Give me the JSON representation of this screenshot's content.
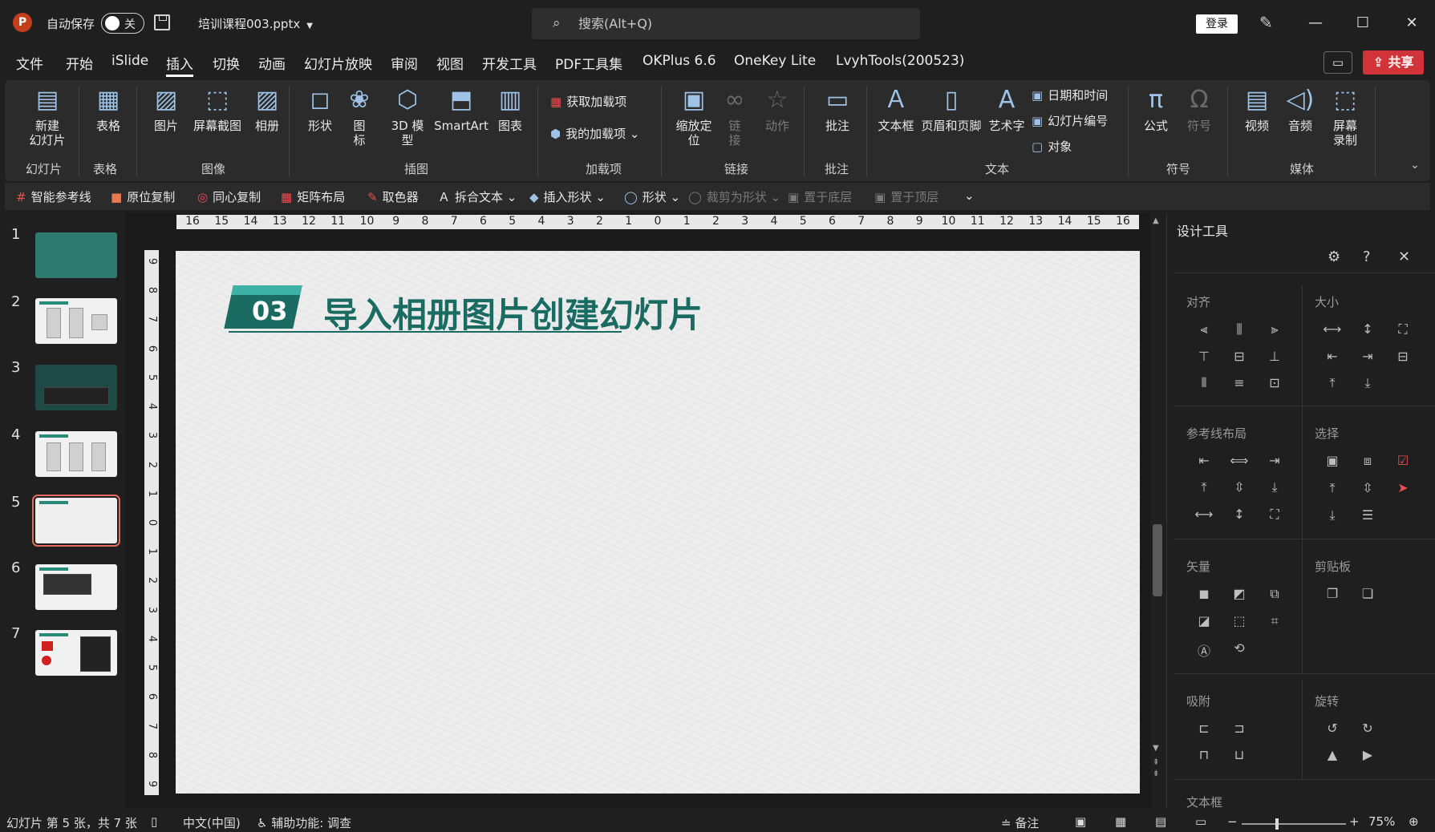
{
  "titlebar": {
    "app_logo": "P",
    "autosave_label": "自动保存",
    "autosave_state": "关",
    "file_name": "培训课程003.pptx",
    "search_placeholder": "搜索(Alt+Q)",
    "login_label": "登录"
  },
  "menu": {
    "items": [
      "文件",
      "开始",
      "iSlide",
      "插入",
      "切换",
      "动画",
      "幻灯片放映",
      "审阅",
      "视图",
      "开发工具",
      "PDF工具集",
      "OKPlus 6.6",
      "OneKey Lite",
      "LvyhTools(200523)"
    ],
    "active": "插入",
    "share_label": "共享"
  },
  "ribbon": {
    "buttons": {
      "new_slide": "新建\n幻灯片",
      "table": "表格",
      "picture": "图片",
      "screenshot": "屏幕截图",
      "album": "相册",
      "shape": "形状",
      "icon": "图\n标",
      "model3d": "3D 模\n型",
      "smartart": "SmartArt",
      "chart": "图表",
      "get_addins": "获取加载项",
      "my_addins": "我的加载项",
      "zoom": "缩放定\n位",
      "link": "链\n接",
      "action": "动作",
      "comment": "批注",
      "textbox": "文本框",
      "header_footer": "页眉和页脚",
      "wordart": "艺术字",
      "date_time": "日期和时间",
      "slide_number": "幻灯片编号",
      "object": "对象",
      "equation": "公式",
      "symbol": "符号",
      "video": "视频",
      "audio": "音频",
      "screen_record": "屏幕\n录制"
    },
    "groups": {
      "slides": "幻灯片",
      "tables": "表格",
      "images": "图像",
      "illustrations": "插图",
      "addins": "加载项",
      "links": "链接",
      "comments": "批注",
      "text": "文本",
      "symbols": "符号",
      "media": "媒体"
    }
  },
  "quickbar": {
    "items": [
      "智能参考线",
      "原位复制",
      "同心复制",
      "矩阵布局",
      "取色器",
      "拆合文本",
      "插入形状",
      "形状",
      "裁剪为形状",
      "置于底层",
      "置于顶层"
    ]
  },
  "ruler": {
    "h_labels": [
      "16",
      "15",
      "14",
      "13",
      "12",
      "11",
      "10",
      "9",
      "8",
      "7",
      "6",
      "5",
      "4",
      "3",
      "2",
      "1",
      "0",
      "1",
      "2",
      "3",
      "4",
      "5",
      "6",
      "7",
      "8",
      "9",
      "10",
      "11",
      "12",
      "13",
      "14",
      "15",
      "16"
    ],
    "v_labels": [
      "9",
      "8",
      "7",
      "6",
      "5",
      "4",
      "3",
      "2",
      "1",
      "0",
      "1",
      "2",
      "3",
      "4",
      "5",
      "6",
      "7",
      "8",
      "9"
    ]
  },
  "slides_panel": {
    "numbers": [
      "1",
      "2",
      "3",
      "4",
      "5",
      "6",
      "7"
    ],
    "active_index": 5
  },
  "slide": {
    "badge_number": "03",
    "title": "导入相册图片创建幻灯片",
    "accent_color": "#1a6b62",
    "accent_light": "#3db1a5"
  },
  "design_panel": {
    "title": "设计工具",
    "sections": {
      "align": "对齐",
      "size": "大小",
      "guide_layout": "参考线布局",
      "select": "选择",
      "vector": "矢量",
      "clipboard": "剪贴板",
      "snap": "吸附",
      "rotate": "旋转",
      "textbox": "文本框"
    }
  },
  "statusbar": {
    "slide_info": "幻灯片 第 5 张，共 7 张",
    "language": "中文(中国)",
    "accessibility": "辅助功能: 调查",
    "notes": "备注",
    "zoom": "75%"
  }
}
